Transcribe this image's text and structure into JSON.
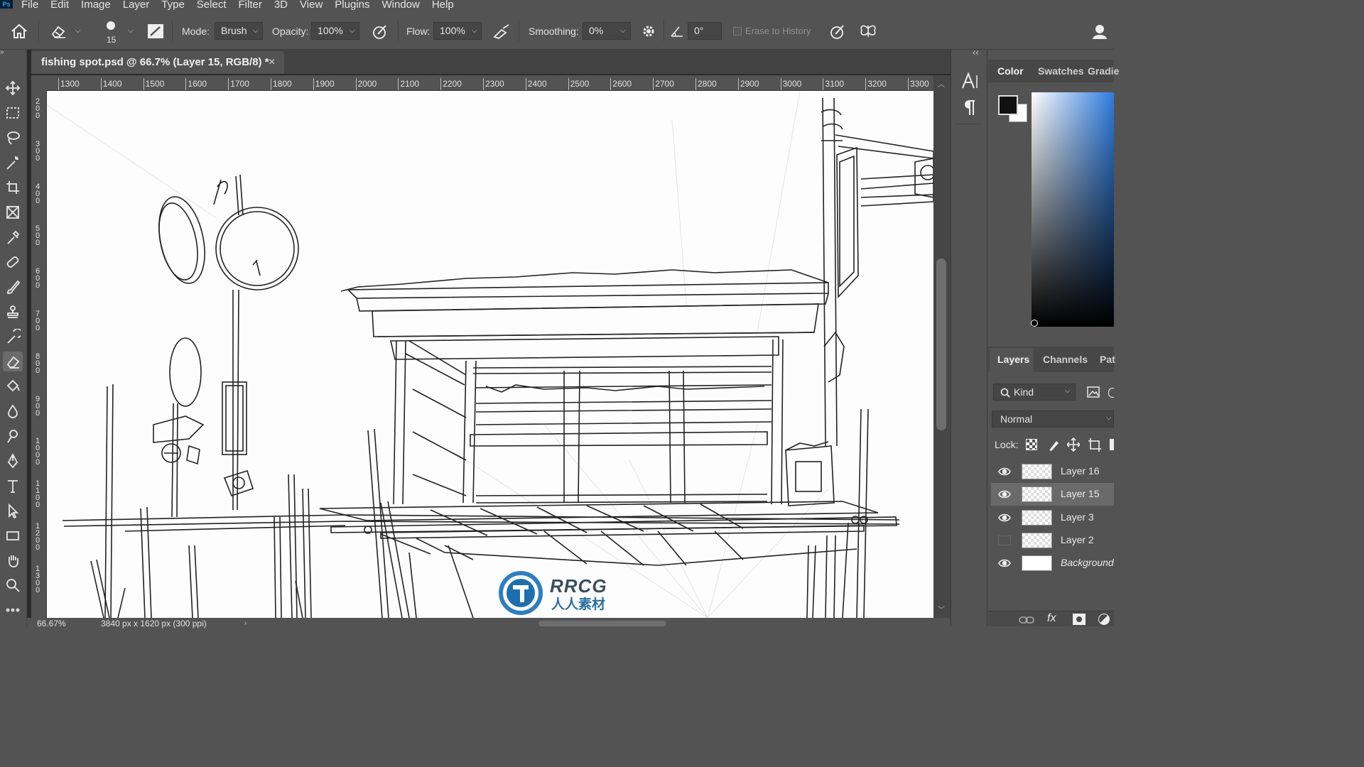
{
  "app": {
    "logo": "Ps"
  },
  "menu": [
    "File",
    "Edit",
    "Image",
    "Layer",
    "Type",
    "Select",
    "Filter",
    "3D",
    "View",
    "Plugins",
    "Window",
    "Help"
  ],
  "options": {
    "brush_size": "15",
    "mode_label": "Mode:",
    "mode_value": "Brush",
    "opacity_label": "Opacity:",
    "opacity_value": "100%",
    "flow_label": "Flow:",
    "flow_value": "100%",
    "smoothing_label": "Smoothing:",
    "smoothing_value": "0%",
    "angle_value": "0°",
    "erase_history_label": "Erase to History"
  },
  "document": {
    "tab_title": "fishing spot.psd @ 66.7% (Layer 15, RGB/8) *",
    "close_glyph": "×",
    "ruler_h": [
      "1300",
      "1400",
      "1500",
      "1600",
      "1700",
      "1800",
      "1900",
      "2000",
      "2100",
      "2200",
      "2300",
      "2400",
      "2500",
      "2600",
      "2700",
      "2800",
      "2900",
      "3000",
      "3100",
      "3200",
      "3300"
    ],
    "ruler_v": [
      "200",
      "300",
      "400",
      "500",
      "600",
      "700",
      "800",
      "900",
      "1000",
      "1100",
      "1200",
      "1300"
    ],
    "zoom": "66.67%",
    "doc_info": "3840 px x 1620 px (300 ppi)",
    "watermark_title": "RRCG",
    "watermark_sub": "人人素材"
  },
  "panels": {
    "collapse_glyph": "‹‹",
    "color_tabs": [
      "Color",
      "Swatches",
      "Gradie"
    ],
    "layers_tabs": [
      "Layers",
      "Channels",
      "Pat"
    ],
    "kind_label": "Kind",
    "blend_mode": "Normal",
    "lock_label": "Lock:",
    "layers": [
      {
        "name": "Layer 16",
        "visible": true,
        "selected": false
      },
      {
        "name": "Layer 15",
        "visible": true,
        "selected": true
      },
      {
        "name": "Layer 3",
        "visible": true,
        "selected": false
      },
      {
        "name": "Layer 2",
        "visible": false,
        "selected": false
      },
      {
        "name": "Background",
        "visible": true,
        "selected": false
      }
    ],
    "footer_icons": [
      "link-icon",
      "fx-icon",
      "mask-icon",
      "adjustment-icon"
    ],
    "fx_label": "fx"
  },
  "colors": {
    "foreground": "#111111",
    "background": "#ffffff",
    "ui_bg": "#535353"
  },
  "tools": [
    "move-icon",
    "marquee-icon",
    "lasso-icon",
    "magic-wand-icon",
    "crop-icon",
    "frame-icon",
    "eyedropper-icon",
    "healing-brush-icon",
    "brush-icon",
    "clone-stamp-icon",
    "history-brush-icon",
    "eraser-icon",
    "paint-bucket-icon",
    "blur-icon",
    "dodge-icon",
    "pen-icon",
    "type-icon",
    "path-select-icon",
    "rectangle-icon",
    "hand-icon",
    "zoom-icon",
    "more-tools-icon"
  ]
}
